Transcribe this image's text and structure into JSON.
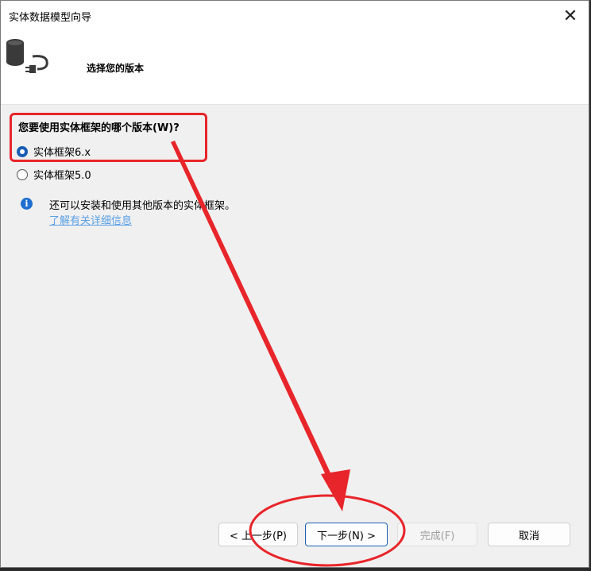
{
  "window": {
    "title": "实体数据模型向导",
    "close_glyph": "✕"
  },
  "header": {
    "title": "选择您的版本"
  },
  "question": "您要使用实体框架的哪个版本(W)?",
  "options": [
    {
      "label": "实体框架6.x",
      "selected": true
    },
    {
      "label": "实体框架5.0",
      "selected": false
    }
  ],
  "info": {
    "icon_glyph": "i",
    "text": "还可以安装和使用其他版本的实体框架。",
    "link": "了解有关详细信息"
  },
  "buttons": {
    "back": "< 上一步(P)",
    "next": "下一步(N) >",
    "finish": "完成(F)",
    "cancel": "取消"
  },
  "colors": {
    "annotation": "#e8252a",
    "accent": "#1a5fb4",
    "link": "#5aa0e6"
  }
}
